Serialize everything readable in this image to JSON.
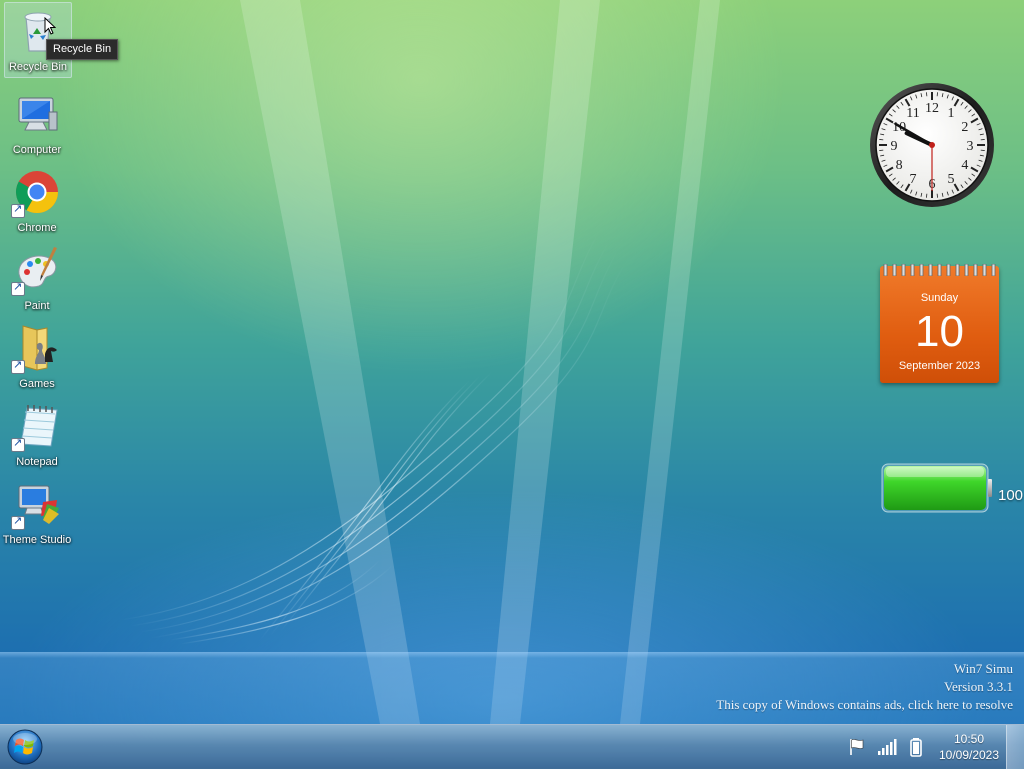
{
  "desktop": {
    "icons": [
      {
        "label": "Recycle Bin",
        "icon": "recycle-bin-icon",
        "shortcut": false
      },
      {
        "label": "Computer",
        "icon": "computer-icon",
        "shortcut": false
      },
      {
        "label": "Chrome",
        "icon": "chrome-icon",
        "shortcut": true
      },
      {
        "label": "Paint",
        "icon": "paint-palette-icon",
        "shortcut": true
      },
      {
        "label": "Games",
        "icon": "games-folder-icon",
        "shortcut": true
      },
      {
        "label": "Notepad",
        "icon": "notepad-icon",
        "shortcut": true
      },
      {
        "label": "Theme Studio",
        "icon": "theme-studio-icon",
        "shortcut": true
      }
    ],
    "tooltip": "Recycle Bin"
  },
  "gadgets": {
    "clock": {
      "hour": 9,
      "minute": 50,
      "second": 30,
      "numerals": [
        "12",
        "1",
        "2",
        "3",
        "4",
        "5",
        "6",
        "7",
        "8",
        "9",
        "10",
        "11"
      ]
    },
    "calendar": {
      "day_name": "Sunday",
      "date": "10",
      "month_year": "September 2023"
    },
    "battery": {
      "percent": "100",
      "level": 1.0
    }
  },
  "watermark": {
    "line1": "Win7 Simu",
    "line2": "Version 3.3.1",
    "line3": "This copy of Windows contains ads, click here to resolve"
  },
  "taskbar": {
    "start_icon": "windows-logo-icon",
    "tray_icons": [
      "action-center-flag-icon",
      "network-signal-icon",
      "battery-icon"
    ],
    "time": "10:50",
    "date": "10/09/2023"
  },
  "colors": {
    "calendar_orange": "#e05d10",
    "battery_green": "#3fd62a",
    "tooltip_bg": "#2b2b2b"
  }
}
